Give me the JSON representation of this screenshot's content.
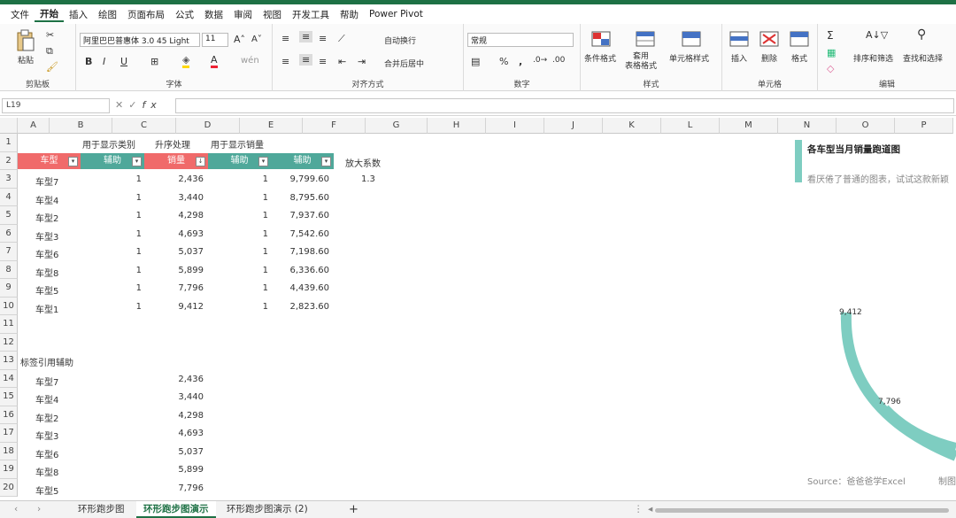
{
  "menu": [
    "文件",
    "开始",
    "插入",
    "绘图",
    "页面布局",
    "公式",
    "数据",
    "审阅",
    "视图",
    "开发工具",
    "帮助",
    "Power Pivot"
  ],
  "ribbon": {
    "paste_label": "粘贴",
    "clipboard_label": "剪贴板",
    "font_name": "阿里巴巴普惠体 3.0 45 Light",
    "font_size": "11",
    "font_group_label": "字体",
    "wrap_text": "自动换行",
    "merge_center": "合并后居中",
    "align_group_label": "对齐方式",
    "number_format": "常规",
    "number_group_label": "数字",
    "cond_format": "条件格式",
    "table_format": "套用\n表格格式",
    "cell_style": "单元格样式",
    "style_group_label": "样式",
    "insert": "插入",
    "delete": "删除",
    "format": "格式",
    "cells_group_label": "单元格",
    "sort_filter": "排序和筛选",
    "find_select": "查找和选择",
    "edit_group_label": "编辑"
  },
  "formula_bar": {
    "name_box": "L19",
    "formula": ""
  },
  "columns": [
    "A",
    "B",
    "C",
    "D",
    "E",
    "F",
    "G",
    "H",
    "I",
    "J",
    "K",
    "L",
    "M",
    "N",
    "O",
    "P"
  ],
  "rows": [
    "1",
    "2",
    "3",
    "4",
    "5",
    "6",
    "7",
    "8",
    "9",
    "10",
    "11",
    "12",
    "13",
    "14",
    "15",
    "16",
    "17",
    "18",
    "19",
    "20"
  ],
  "row1_labels": {
    "b": "用于显示类别",
    "c": "升序处理",
    "d": "用于显示销量"
  },
  "table_headers": {
    "a": "车型",
    "b": "辅助",
    "c": "销量",
    "d": "辅助",
    "e": "辅助"
  },
  "scale_label": "放大系数",
  "scale_value": "1.3",
  "table_rows": [
    {
      "a": "车型7",
      "b": "1",
      "c": "2,436",
      "d": "1",
      "e": "9,799.60"
    },
    {
      "a": "车型4",
      "b": "1",
      "c": "3,440",
      "d": "1",
      "e": "8,795.60"
    },
    {
      "a": "车型2",
      "b": "1",
      "c": "4,298",
      "d": "1",
      "e": "7,937.60"
    },
    {
      "a": "车型3",
      "b": "1",
      "c": "4,693",
      "d": "1",
      "e": "7,542.60"
    },
    {
      "a": "车型6",
      "b": "1",
      "c": "5,037",
      "d": "1",
      "e": "7,198.60"
    },
    {
      "a": "车型8",
      "b": "1",
      "c": "5,899",
      "d": "1",
      "e": "6,336.60"
    },
    {
      "a": "车型5",
      "b": "1",
      "c": "7,796",
      "d": "1",
      "e": "4,439.60"
    },
    {
      "a": "车型1",
      "b": "1",
      "c": "9,412",
      "d": "1",
      "e": "2,823.60"
    }
  ],
  "label_ref_title": "标签引用辅助",
  "label_rows": [
    {
      "a": "车型7",
      "c": "2,436"
    },
    {
      "a": "车型4",
      "c": "3,440"
    },
    {
      "a": "车型2",
      "c": "4,298"
    },
    {
      "a": "车型3",
      "c": "4,693"
    },
    {
      "a": "车型6",
      "c": "5,037"
    },
    {
      "a": "车型8",
      "c": "5,899"
    },
    {
      "a": "车型5",
      "c": "7,796"
    }
  ],
  "chart": {
    "title": "各车型当月销量跑道图",
    "subtitle": "看厌倦了普通的图表，试试这款新颖",
    "label_a": "9,412",
    "label_b": "7,796",
    "source": "Source：爸爸爸学Excel",
    "maker": "制图",
    "accent": "#7ecdc1"
  },
  "colors": {
    "red_header": "#f06a6a",
    "teal_header": "#4fa89a",
    "accent_green": "#1e7145"
  },
  "sheet_tabs": [
    "环形跑步图",
    "环形跑步图演示",
    "环形跑步图演示 (2)"
  ],
  "active_tab": 1
}
